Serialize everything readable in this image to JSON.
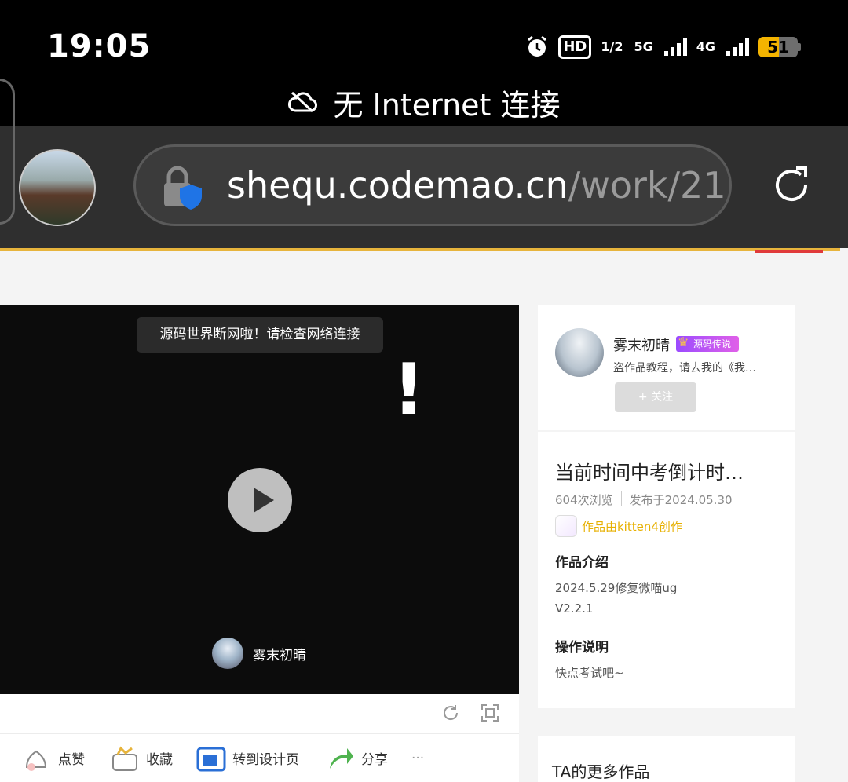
{
  "status_bar": {
    "time": "19:05",
    "hd_label": "HD",
    "hd_sub": "1/2",
    "net1": "5G",
    "net2": "4G",
    "battery": "51",
    "battery_color": "#f4b400"
  },
  "network_warning": {
    "icon": "cloud-off-icon",
    "text": "无 Internet 连接"
  },
  "browser": {
    "url_host": "shequ.codemao.cn",
    "url_path": "/work/21(",
    "lock_icon": "lock-shield-icon",
    "reload_icon": "reload-icon"
  },
  "player": {
    "toast": "源码世界断网啦！请检查网络连接",
    "exclamation": "!",
    "author": "雾末初晴"
  },
  "actions": [
    {
      "label": "点赞",
      "icon": "like-icon"
    },
    {
      "label": "收藏",
      "icon": "collect-icon"
    },
    {
      "label": "转到设计页",
      "icon": "design-page-icon"
    },
    {
      "label": "分享",
      "icon": "share-icon"
    }
  ],
  "more_label": "···",
  "author_card": {
    "name": "雾末初晴",
    "badge": "源码传说",
    "bio": "盗作品教程，请去我的《我…",
    "follow": "+ 关注"
  },
  "work": {
    "title": "当前时间中考倒计时…",
    "views": "604次浏览",
    "published": "发布于2024.05.30",
    "tool": "作品由kitten4创作",
    "intro_heading": "作品介绍",
    "intro_lines": [
      "2024.5.29修复微喵ug",
      "V2.2.1"
    ],
    "ops_heading": "操作说明",
    "ops_text": "快点考试吧~"
  },
  "more_works_title": "TA的更多作品",
  "colors": {
    "accent_yellow": "#e7b43c",
    "accent_red": "#e03a3a",
    "tool_text": "#e7b000"
  }
}
